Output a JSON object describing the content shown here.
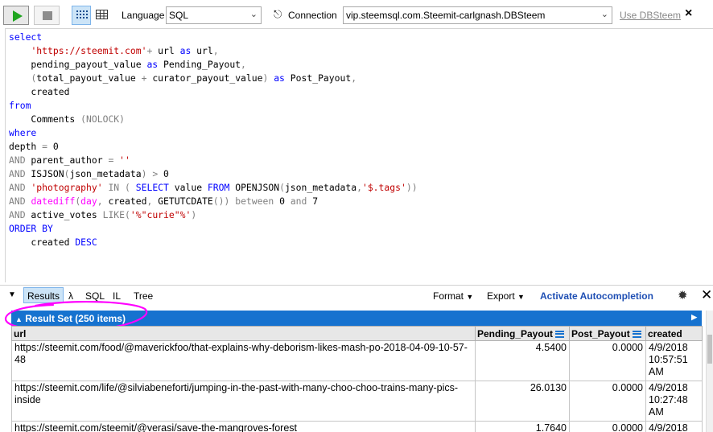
{
  "toolbar": {
    "language_label": "Language",
    "language_value": "SQL",
    "connection_label": "Connection",
    "connection_value": "vip.steemsql.com.Steemit-carlgnash.DBSteem",
    "use_db_link": "Use DBSteem",
    "close_label": "×"
  },
  "editor": {
    "lines": [
      [
        {
          "t": "select",
          "c": "kw"
        }
      ],
      [
        {
          "t": "    ",
          "c": "tx"
        },
        {
          "t": "'https://steemit.com'",
          "c": "str"
        },
        {
          "t": "+",
          "c": "gr"
        },
        {
          "t": " url ",
          "c": "tx"
        },
        {
          "t": "as",
          "c": "kw"
        },
        {
          "t": " url",
          "c": "tx"
        },
        {
          "t": ",",
          "c": "gr"
        }
      ],
      [
        {
          "t": "    pending_payout_value ",
          "c": "tx"
        },
        {
          "t": "as",
          "c": "kw"
        },
        {
          "t": " Pending_Payout",
          "c": "tx"
        },
        {
          "t": ",",
          "c": "gr"
        }
      ],
      [
        {
          "t": "    ",
          "c": "tx"
        },
        {
          "t": "(",
          "c": "gr"
        },
        {
          "t": "total_payout_value ",
          "c": "tx"
        },
        {
          "t": "+",
          "c": "gr"
        },
        {
          "t": " curator_payout_value",
          "c": "tx"
        },
        {
          "t": ")",
          "c": "gr"
        },
        {
          "t": " ",
          "c": "tx"
        },
        {
          "t": "as",
          "c": "kw"
        },
        {
          "t": " Post_Payout",
          "c": "tx"
        },
        {
          "t": ",",
          "c": "gr"
        }
      ],
      [
        {
          "t": "    created",
          "c": "tx"
        }
      ],
      [
        {
          "t": "from",
          "c": "kw"
        }
      ],
      [
        {
          "t": "    Comments ",
          "c": "tx"
        },
        {
          "t": "(NOLOCK)",
          "c": "gr"
        }
      ],
      [
        {
          "t": "where",
          "c": "kw"
        }
      ],
      [
        {
          "t": "depth ",
          "c": "tx"
        },
        {
          "t": "=",
          "c": "gr"
        },
        {
          "t": " 0",
          "c": "tx"
        }
      ],
      [
        {
          "t": "AND",
          "c": "gr"
        },
        {
          "t": " parent_author ",
          "c": "tx"
        },
        {
          "t": "=",
          "c": "gr"
        },
        {
          "t": " ",
          "c": "tx"
        },
        {
          "t": "''",
          "c": "str"
        }
      ],
      [
        {
          "t": "AND",
          "c": "gr"
        },
        {
          "t": " ISJSON",
          "c": "tx"
        },
        {
          "t": "(",
          "c": "gr"
        },
        {
          "t": "json_metadata",
          "c": "tx"
        },
        {
          "t": ")",
          "c": "gr"
        },
        {
          "t": " ",
          "c": "tx"
        },
        {
          "t": ">",
          "c": "gr"
        },
        {
          "t": " 0",
          "c": "tx"
        }
      ],
      [
        {
          "t": "AND",
          "c": "gr"
        },
        {
          "t": " ",
          "c": "tx"
        },
        {
          "t": "'photography'",
          "c": "str"
        },
        {
          "t": " ",
          "c": "tx"
        },
        {
          "t": "IN",
          "c": "gr"
        },
        {
          "t": " ",
          "c": "tx"
        },
        {
          "t": "(",
          "c": "gr"
        },
        {
          "t": " ",
          "c": "tx"
        },
        {
          "t": "SELECT",
          "c": "kw"
        },
        {
          "t": " value ",
          "c": "tx"
        },
        {
          "t": "FROM",
          "c": "kw"
        },
        {
          "t": " OPENJSON",
          "c": "tx"
        },
        {
          "t": "(",
          "c": "gr"
        },
        {
          "t": "json_metadata",
          "c": "tx"
        },
        {
          "t": ",",
          "c": "gr"
        },
        {
          "t": "'$.tags'",
          "c": "str"
        },
        {
          "t": "))",
          "c": "gr"
        }
      ],
      [
        {
          "t": "AND",
          "c": "gr"
        },
        {
          "t": " ",
          "c": "tx"
        },
        {
          "t": "datediff",
          "c": "fn"
        },
        {
          "t": "(",
          "c": "gr"
        },
        {
          "t": "day",
          "c": "fn"
        },
        {
          "t": ",",
          "c": "gr"
        },
        {
          "t": " created",
          "c": "tx"
        },
        {
          "t": ",",
          "c": "gr"
        },
        {
          "t": " GETUTCDATE",
          "c": "tx"
        },
        {
          "t": "())",
          "c": "gr"
        },
        {
          "t": " ",
          "c": "tx"
        },
        {
          "t": "between",
          "c": "gr"
        },
        {
          "t": " 0 ",
          "c": "tx"
        },
        {
          "t": "and",
          "c": "gr"
        },
        {
          "t": " 7",
          "c": "tx"
        }
      ],
      [
        {
          "t": "AND",
          "c": "gr"
        },
        {
          "t": " active_votes ",
          "c": "tx"
        },
        {
          "t": "LIKE",
          "c": "gr"
        },
        {
          "t": "(",
          "c": "gr"
        },
        {
          "t": "'%\"curie\"%'",
          "c": "str"
        },
        {
          "t": ")",
          "c": "gr"
        }
      ],
      [
        {
          "t": "ORDER BY",
          "c": "kw"
        }
      ],
      [
        {
          "t": "    created ",
          "c": "tx"
        },
        {
          "t": "DESC",
          "c": "kw"
        }
      ]
    ]
  },
  "result_toolbar": {
    "tabs": [
      "Results",
      "λ",
      "SQL",
      "IL",
      "Tree"
    ],
    "format_label": "Format",
    "export_label": "Export",
    "autocompletion_label": "Activate Autocompletion"
  },
  "result_set": {
    "title": "Result Set (250 items)",
    "columns": [
      "url",
      "Pending_Payout",
      "Post_Payout",
      "created"
    ],
    "rows": [
      [
        "https://steemit.com/food/@maverickfoo/that-explains-why-deborism-likes-mash-po-2018-04-09-10-57-48",
        "4.5400",
        "0.0000",
        "4/9/2018 10:57:51 AM"
      ],
      [
        "https://steemit.com/life/@silviabeneforti/jumping-in-the-past-with-many-choo-choo-trains-many-pics-inside",
        "26.0130",
        "0.0000",
        "4/9/2018 10:27:48 AM"
      ],
      [
        "https://steemit.com/steemit/@verasi/save-the-mangroves-forest",
        "1.7640",
        "0.0000",
        "4/9/2018"
      ]
    ]
  },
  "colors": {
    "accent_blue": "#1672cf",
    "annotation_magenta": "#ff00ff",
    "run_green": "#1fa51f"
  }
}
